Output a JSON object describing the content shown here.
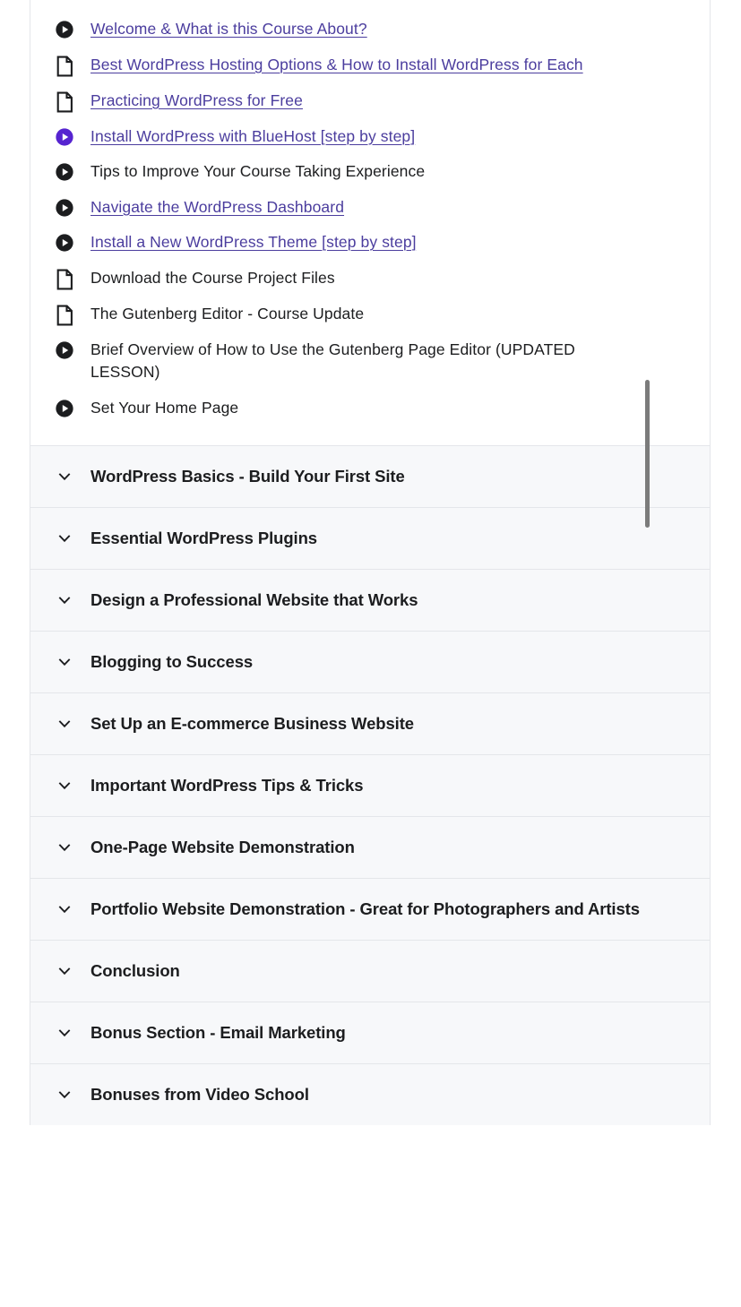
{
  "colors": {
    "link": "#4b3d9e",
    "accent_purple": "#5624d0",
    "text": "#1c1d1f",
    "section_bg": "#f7f8fa",
    "border": "#e4e6ea",
    "scrollbar": "#7b7b7b"
  },
  "curriculum": {
    "expanded_section": {
      "lessons": [
        {
          "icon": "play-circle-icon",
          "icon_state": "default",
          "title": "Welcome & What is this Course About?",
          "is_link": true
        },
        {
          "icon": "document-icon",
          "icon_state": "default",
          "title": "Best WordPress Hosting Options & How to Install WordPress for Each",
          "is_link": true
        },
        {
          "icon": "document-icon",
          "icon_state": "default",
          "title": "Practicing WordPress for Free",
          "is_link": true
        },
        {
          "icon": "play-circle-icon",
          "icon_state": "active",
          "title": "Install WordPress with BlueHost [step by step]",
          "is_link": true
        },
        {
          "icon": "play-circle-icon",
          "icon_state": "default",
          "title": "Tips to Improve Your Course Taking Experience",
          "is_link": false
        },
        {
          "icon": "play-circle-icon",
          "icon_state": "default",
          "title": "Navigate the WordPress Dashboard",
          "is_link": true
        },
        {
          "icon": "play-circle-icon",
          "icon_state": "default",
          "title": "Install a New WordPress Theme [step by step]",
          "is_link": true
        },
        {
          "icon": "document-icon",
          "icon_state": "default",
          "title": "Download the Course Project Files",
          "is_link": false
        },
        {
          "icon": "document-icon",
          "icon_state": "default",
          "title": "The Gutenberg Editor - Course Update",
          "is_link": false
        },
        {
          "icon": "play-circle-icon",
          "icon_state": "default",
          "title": "Brief Overview of How to Use the Gutenberg Page Editor (UPDATED LESSON)",
          "is_link": false
        },
        {
          "icon": "play-circle-icon",
          "icon_state": "default",
          "title": "Set Your Home Page",
          "is_link": false
        }
      ]
    },
    "collapsed_sections": [
      {
        "icon": "chevron-down-icon",
        "title": "WordPress Basics - Build Your First Site"
      },
      {
        "icon": "chevron-down-icon",
        "title": "Essential WordPress Plugins"
      },
      {
        "icon": "chevron-down-icon",
        "title": "Design a Professional Website that Works"
      },
      {
        "icon": "chevron-down-icon",
        "title": "Blogging to Success"
      },
      {
        "icon": "chevron-down-icon",
        "title": "Set Up an E-commerce Business Website"
      },
      {
        "icon": "chevron-down-icon",
        "title": "Important WordPress Tips & Tricks"
      },
      {
        "icon": "chevron-down-icon",
        "title": "One-Page Website Demonstration"
      },
      {
        "icon": "chevron-down-icon",
        "title": "Portfolio Website Demonstration - Great for Photographers and Artists"
      },
      {
        "icon": "chevron-down-icon",
        "title": "Conclusion"
      },
      {
        "icon": "chevron-down-icon",
        "title": "Bonus Section - Email Marketing"
      },
      {
        "icon": "chevron-down-icon",
        "title": "Bonuses from Video School"
      }
    ]
  }
}
